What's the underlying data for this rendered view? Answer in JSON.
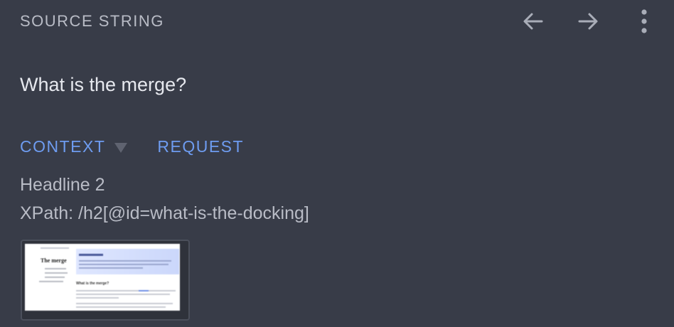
{
  "header": {
    "title": "SOURCE STRING",
    "icons": [
      "arrow-left-icon",
      "arrow-right-icon",
      "more-vertical-icon"
    ]
  },
  "source": {
    "text": "What is the merge?"
  },
  "tabs": [
    {
      "label": "CONTEXT",
      "has_dropdown": true
    },
    {
      "label": "REQUEST",
      "has_dropdown": false
    }
  ],
  "context": {
    "element_type": "Headline 2",
    "xpath": "XPath: /h2[@id=what-is-the-docking]",
    "screenshot": {
      "heading": "The merge",
      "section_heading": "What is the merge?"
    }
  },
  "colors": {
    "background": "#383c48",
    "muted_text": "#b9bcc6",
    "primary_text": "#e6e8ee",
    "accent": "#6e9cf0"
  }
}
